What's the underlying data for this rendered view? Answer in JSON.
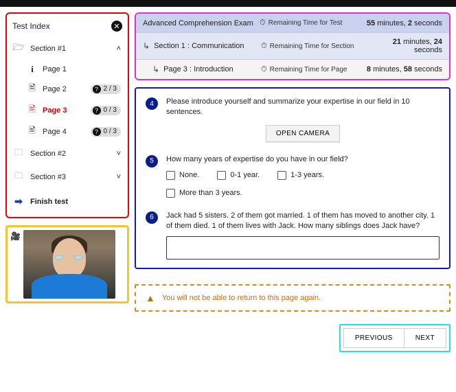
{
  "sidebar": {
    "title": "Test Index",
    "sections": [
      {
        "label": "Section #1",
        "expanded": true
      },
      {
        "label": "Section #2",
        "expanded": false
      },
      {
        "label": "Section #3",
        "expanded": false
      }
    ],
    "pages": [
      {
        "label": "Page 1",
        "badge": null
      },
      {
        "label": "Page 2",
        "badge": "2 / 3"
      },
      {
        "label": "Page 3",
        "badge": "0 / 3",
        "active": true
      },
      {
        "label": "Page 4",
        "badge": "0 / 3"
      }
    ],
    "finish": "Finish test"
  },
  "timers": {
    "rows": [
      {
        "title": "Advanced Comprehension Exam",
        "mid": "Remaining Time for Test",
        "min": "55",
        "min_unit": "minutes,",
        "sec": "2",
        "sec_unit": "seconds"
      },
      {
        "title": "Section 1  : Communication",
        "mid": "Remaining Time for Section",
        "min": "21",
        "min_unit": "minutes,",
        "sec": "24",
        "sec_unit": "seconds"
      },
      {
        "title": "Page 3  :  Introduction",
        "mid": "Remaining Time for Page",
        "min": "8",
        "min_unit": "minutes,",
        "sec": "58",
        "sec_unit": "seconds"
      }
    ]
  },
  "questions": {
    "q4": {
      "num": "4",
      "text": "Please introduce yourself and summarize your expertise in our field in 10 sentences.",
      "button": "OPEN CAMERA"
    },
    "q5": {
      "num": "5",
      "text": "How many years of expertise do you have in our field?",
      "opts": [
        "None.",
        "0-1 year.",
        "1-3 years.",
        "More than 3 years."
      ]
    },
    "q6": {
      "num": "6",
      "text": "Jack had 5 sisters. 2 of them got married. 1 of them has moved to another city. 1 of them died. 1 of them lives with Jack. How many siblings does Jack have?"
    }
  },
  "warning": "You will not be able to return to this page again.",
  "nav": {
    "prev": "PREVIOUS",
    "next": "NEXT"
  }
}
